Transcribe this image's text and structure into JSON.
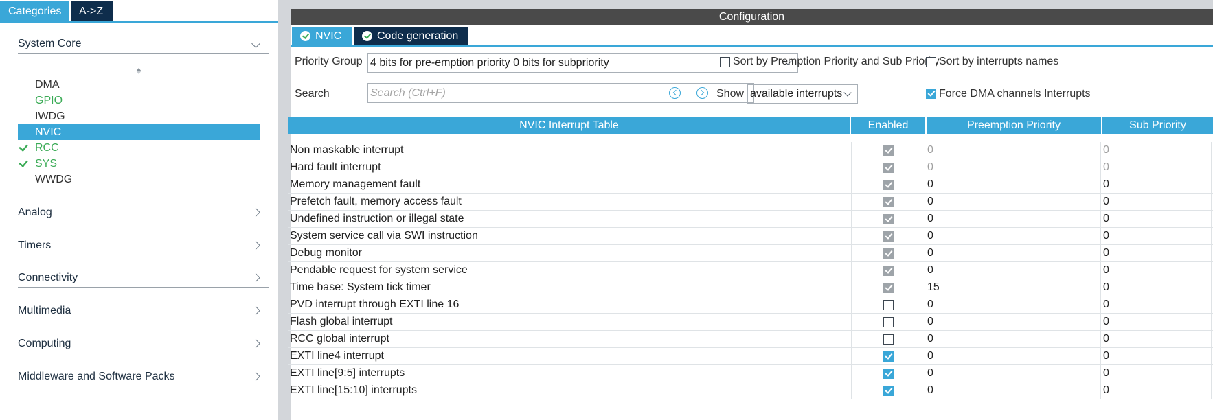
{
  "left": {
    "tabs": [
      {
        "label": "Categories",
        "active": true
      },
      {
        "label": "A->Z",
        "active": false
      }
    ],
    "system_core": {
      "label": "System Core",
      "items": [
        {
          "label": "DMA",
          "status": "none"
        },
        {
          "label": "GPIO",
          "status": "configured"
        },
        {
          "label": "IWDG",
          "status": "none"
        },
        {
          "label": "NVIC",
          "status": "selected"
        },
        {
          "label": "RCC",
          "status": "checked"
        },
        {
          "label": "SYS",
          "status": "checked"
        },
        {
          "label": "WWDG",
          "status": "none"
        }
      ]
    },
    "categories": [
      {
        "label": "Analog"
      },
      {
        "label": "Timers"
      },
      {
        "label": "Connectivity"
      },
      {
        "label": "Multimedia"
      },
      {
        "label": "Computing"
      },
      {
        "label": "Middleware and Software Packs"
      }
    ]
  },
  "config": {
    "title": "Configuration",
    "tabs": [
      {
        "label": "NVIC",
        "active": true
      },
      {
        "label": "Code generation",
        "active": false
      }
    ],
    "priority_group_label": "Priority Group",
    "priority_group_value": "4 bits for pre-emption priority 0 bits for subpriority",
    "sort_premption_label": "Sort by Premption Priority and Sub Priority",
    "sort_premption_checked": false,
    "sort_names_label": "Sort by interrupts names",
    "sort_names_checked": false,
    "search_label": "Search",
    "search_placeholder": "Search (Ctrl+F)",
    "show_label": "Show",
    "show_value": "available interrupts",
    "force_dma_label": "Force DMA channels Interrupts",
    "force_dma_checked": true
  },
  "table": {
    "headers": [
      "NVIC Interrupt Table",
      "Enabled",
      "Preemption Priority",
      "Sub Priority"
    ],
    "rows": [
      {
        "name": "Non maskable interrupt",
        "enabled": true,
        "locked": true,
        "preemption": "0",
        "sub": "0",
        "muted": true
      },
      {
        "name": "Hard fault interrupt",
        "enabled": true,
        "locked": true,
        "preemption": "0",
        "sub": "0",
        "muted": true
      },
      {
        "name": "Memory management fault",
        "enabled": true,
        "locked": true,
        "preemption": "0",
        "sub": "0",
        "muted": false
      },
      {
        "name": "Prefetch fault, memory access fault",
        "enabled": true,
        "locked": true,
        "preemption": "0",
        "sub": "0",
        "muted": false
      },
      {
        "name": "Undefined instruction or illegal state",
        "enabled": true,
        "locked": true,
        "preemption": "0",
        "sub": "0",
        "muted": false
      },
      {
        "name": "System service call via SWI instruction",
        "enabled": true,
        "locked": true,
        "preemption": "0",
        "sub": "0",
        "muted": false
      },
      {
        "name": "Debug monitor",
        "enabled": true,
        "locked": true,
        "preemption": "0",
        "sub": "0",
        "muted": false
      },
      {
        "name": "Pendable request for system service",
        "enabled": true,
        "locked": true,
        "preemption": "0",
        "sub": "0",
        "muted": false
      },
      {
        "name": "Time base: System tick timer",
        "enabled": true,
        "locked": true,
        "preemption": "15",
        "sub": "0",
        "muted": false
      },
      {
        "name": "PVD interrupt through EXTI line 16",
        "enabled": false,
        "locked": false,
        "preemption": "0",
        "sub": "0",
        "muted": false
      },
      {
        "name": "Flash global interrupt",
        "enabled": false,
        "locked": false,
        "preemption": "0",
        "sub": "0",
        "muted": false
      },
      {
        "name": "RCC global interrupt",
        "enabled": false,
        "locked": false,
        "preemption": "0",
        "sub": "0",
        "muted": false
      },
      {
        "name": "EXTI line4 interrupt",
        "enabled": true,
        "locked": false,
        "preemption": "0",
        "sub": "0",
        "muted": false
      },
      {
        "name": "EXTI line[9:5] interrupts",
        "enabled": true,
        "locked": false,
        "preemption": "0",
        "sub": "0",
        "muted": false
      },
      {
        "name": "EXTI line[15:10] interrupts",
        "enabled": true,
        "locked": false,
        "preemption": "0",
        "sub": "0",
        "muted": false
      }
    ]
  },
  "colors": {
    "accent": "#3aa7d8",
    "dark_tab": "#0e2d4c",
    "configured_green": "#3bab56"
  }
}
